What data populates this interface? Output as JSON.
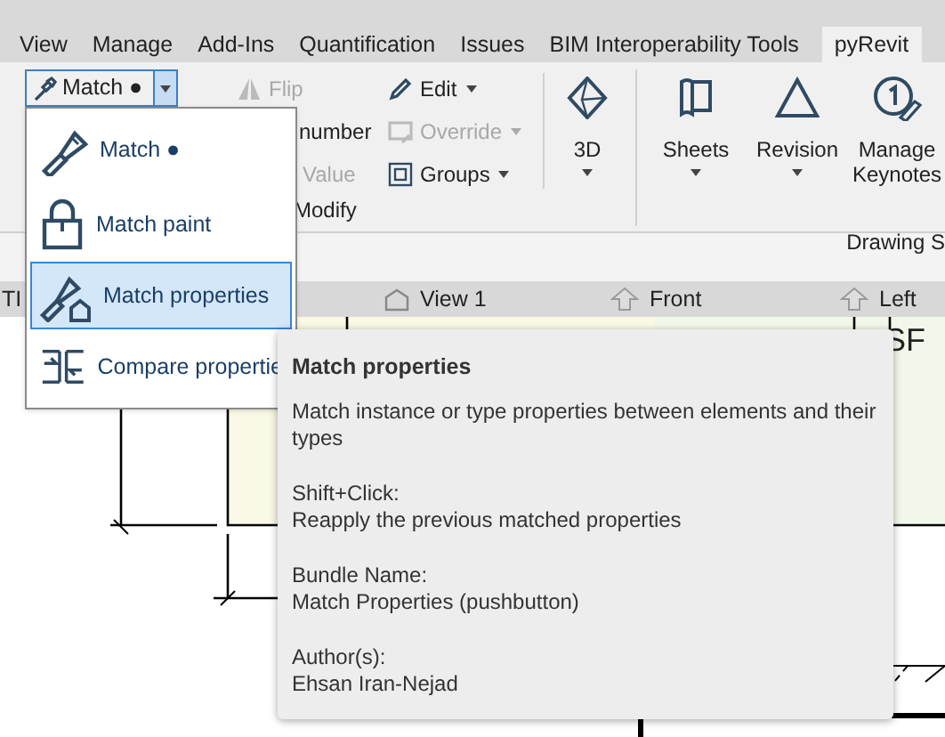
{
  "tabs": [
    {
      "label": "View",
      "selected": false
    },
    {
      "label": "Manage",
      "selected": false
    },
    {
      "label": "Add-Ins",
      "selected": false
    },
    {
      "label": "Quantification",
      "selected": false
    },
    {
      "label": "Issues",
      "selected": false
    },
    {
      "label": "BIM Interoperability Tools",
      "selected": false
    },
    {
      "label": "pyRevit",
      "selected": true
    }
  ],
  "match_button": {
    "label": "Match ●",
    "expanded": true
  },
  "modify_panel": {
    "label": "Modify",
    "columns": [
      [
        {
          "label": "Flip",
          "kind": "flip",
          "disabled": true,
          "dropdown": false
        },
        {
          "label": "number",
          "kind": "hidden",
          "disabled": false,
          "dropdown": false
        },
        {
          "label": "Value",
          "kind": "hidden",
          "disabled": true,
          "dropdown": false
        }
      ],
      [
        {
          "label": "Edit",
          "kind": "edit",
          "disabled": false,
          "dropdown": true
        },
        {
          "label": "Override",
          "kind": "override",
          "disabled": true,
          "dropdown": true
        },
        {
          "label": "Groups",
          "kind": "groups",
          "disabled": false,
          "dropdown": true
        }
      ]
    ]
  },
  "large_buttons": [
    {
      "label": "3D",
      "kind": "cube",
      "dropdown": true
    },
    {
      "label": "Sheets",
      "kind": "sheets",
      "dropdown": true
    },
    {
      "label": "Revision",
      "kind": "triangle",
      "dropdown": true
    },
    {
      "label": "Manage Keynotes",
      "kind": "keynote",
      "dropdown": false
    }
  ],
  "drawing_panel": {
    "label": "Drawing S"
  },
  "view_tabs": [
    {
      "label": "TI",
      "kind": "none"
    },
    {
      "label": "View 1",
      "kind": "house"
    },
    {
      "label": "Front",
      "kind": "arrow"
    },
    {
      "label": "Left",
      "kind": "arrow"
    }
  ],
  "canvas": {
    "label": "SF"
  },
  "menu": [
    {
      "label": "Match ●",
      "kind": "brush",
      "selected": false
    },
    {
      "label": "Match paint",
      "kind": "bucket",
      "selected": false
    },
    {
      "label": "Match properties",
      "kind": "brush-house",
      "selected": true
    },
    {
      "label": "Compare propertie",
      "kind": "compare",
      "selected": false
    }
  ],
  "tooltip": {
    "title": "Match properties",
    "paragraphs": [
      "Match instance or type properties between elements and their types",
      "Shift+Click:\nReapply the previous matched properties",
      "Bundle Name:\nMatch Properties (pushbutton)",
      "Author(s):\nEhsan Iran-Nejad"
    ]
  }
}
